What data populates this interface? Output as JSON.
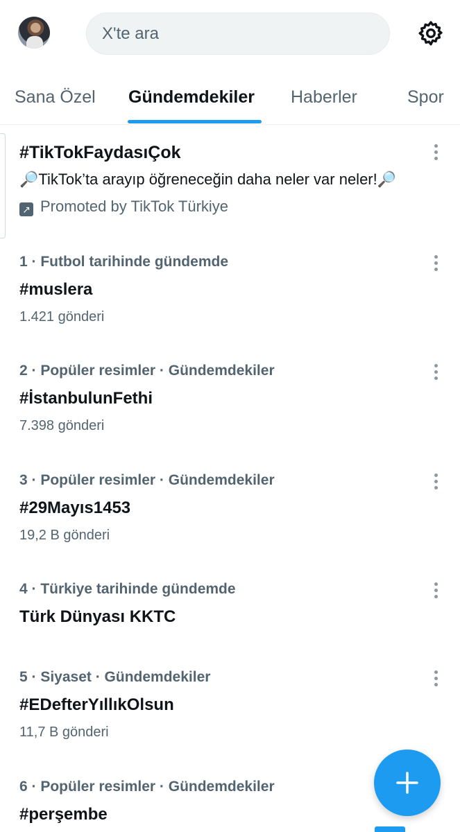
{
  "search": {
    "placeholder": "X'te ara"
  },
  "tabs": [
    {
      "label": "Sana Özel",
      "active": false
    },
    {
      "label": "Gündemdekiler",
      "active": true
    },
    {
      "label": "Haberler",
      "active": false
    },
    {
      "label": "Spor",
      "active": false
    }
  ],
  "promoted": {
    "title": "#TikTokFaydasıÇok",
    "description": "🔎TikTok’ta arayıp öğreneceğin daha neler var neler!🔎",
    "byline": "Promoted by TikTok Türkiye"
  },
  "trends": [
    {
      "meta": "1 · Futbol tarihinde gündemde",
      "title": "#muslera",
      "count": "1.421 gönderi"
    },
    {
      "meta": "2 · Popüler resimler · Gündemdekiler",
      "title": "#İstanbulunFethi",
      "count": "7.398 gönderi"
    },
    {
      "meta": "3 · Popüler resimler · Gündemdekiler",
      "title": "#29Mayıs1453",
      "count": "19,2 B gönderi"
    },
    {
      "meta": "4 · Türkiye tarihinde gündemde",
      "title": "Türk Dünyası KKTC",
      "count": ""
    },
    {
      "meta": "5 · Siyaset · Gündemdekiler",
      "title": "#EDefterYıllıkOlsun",
      "count": "11,7 B gönderi"
    },
    {
      "meta": "6 · Popüler resimler · Gündemdekiler",
      "title": "#perşembe",
      "count": ""
    }
  ],
  "colors": {
    "accent": "#1d9bf0",
    "text": "#0f1419",
    "secondary": "#536471"
  },
  "icons": {
    "settings": "gear-icon",
    "compose": "plus-icon",
    "more": "more-vertical-icon",
    "promoted": "promoted-arrow-icon"
  }
}
